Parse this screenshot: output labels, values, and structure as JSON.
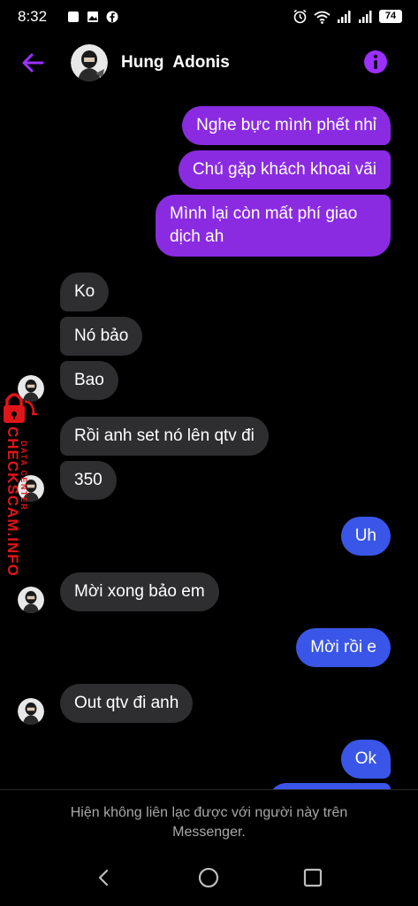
{
  "status_bar": {
    "time": "8:32",
    "battery": "74"
  },
  "header": {
    "name": "Hung  Adonis"
  },
  "messages": [
    {
      "text": "Nghe bực mình phết nhỉ"
    },
    {
      "text": "Chú gặp khách khoai vãi"
    },
    {
      "line1": "Mình lại còn mất phí giao",
      "line2": "dịch ah"
    },
    {
      "text": "Ko"
    },
    {
      "text": "Nó bảo"
    },
    {
      "text": "Bao"
    },
    {
      "text": "Rồi anh set nó lên qtv đi"
    },
    {
      "text": "350"
    },
    {
      "text": "Uh"
    },
    {
      "text": "Mời xong bảo em"
    },
    {
      "text": "Mời rồi e"
    },
    {
      "text": "Out qtv đi anh"
    },
    {
      "text": "Ok"
    }
  ],
  "watermark": {
    "top": "DATA CENTER",
    "main": "CHECKSCAM.INFO"
  },
  "footer": {
    "line1": "Hiện không liên lạc được với người này trên",
    "line2": "Messenger."
  },
  "colors": {
    "outgoing_purple": "#8a2be2",
    "outgoing_blue": "#3a56e8",
    "incoming": "#2e2e30",
    "accent": "#9b30ff",
    "watermark_red": "#e0151a"
  },
  "icons": [
    "wifi-icon",
    "signal-icon",
    "alarm-icon",
    "back-arrow-icon",
    "info-icon"
  ]
}
